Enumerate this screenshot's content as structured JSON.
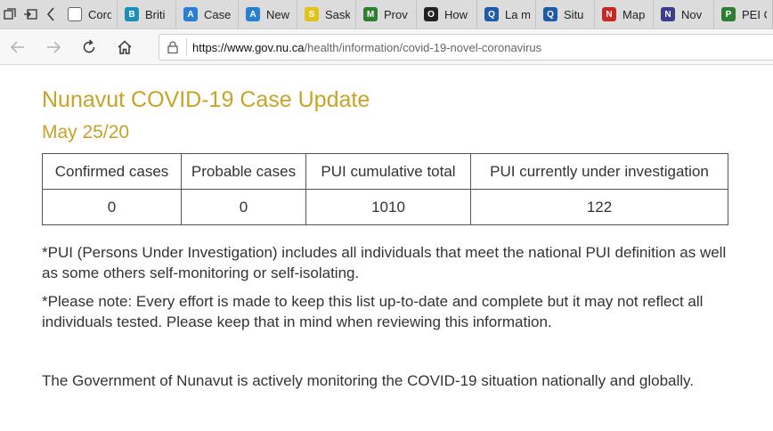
{
  "browser": {
    "tabs": [
      {
        "title": "Coro",
        "icon": "document-icon",
        "color": "#666666",
        "glyph": ""
      },
      {
        "title": "Briti",
        "icon": "bc-gov-icon",
        "color": "#1a8fb5",
        "glyph": "B"
      },
      {
        "title": "Case",
        "icon": "alberta-icon",
        "color": "#2a7fd0",
        "glyph": "A"
      },
      {
        "title": "New",
        "icon": "alberta-icon",
        "color": "#2a7fd0",
        "glyph": "A"
      },
      {
        "title": "Sask",
        "icon": "saskatchewan-icon",
        "color": "#e3c21a",
        "glyph": "S"
      },
      {
        "title": "Prov",
        "icon": "manitoba-icon",
        "color": "#2e7d32",
        "glyph": "M"
      },
      {
        "title": "How",
        "icon": "ontario-icon",
        "color": "#222222",
        "glyph": "O"
      },
      {
        "title": "La m",
        "icon": "quebec-fleur-icon",
        "color": "#1e5aa8",
        "glyph": "Q"
      },
      {
        "title": "Situ",
        "icon": "quebec-fleur-icon",
        "color": "#1e5aa8",
        "glyph": "Q"
      },
      {
        "title": "Map",
        "icon": "nova-scotia-icon",
        "color": "#c62828",
        "glyph": "N"
      },
      {
        "title": "Nov",
        "icon": "new-brunswick-icon",
        "color": "#3c3c8c",
        "glyph": "N"
      },
      {
        "title": "PEI C",
        "icon": "pei-icon",
        "color": "#2e7d32",
        "glyph": "P"
      }
    ],
    "url_host": "https://www.gov.nu.ca",
    "url_path": "/health/information/covid-19-novel-coronavirus"
  },
  "page": {
    "title": "Nunavut COVID-19 Case Update",
    "date": "May 25/20",
    "table": {
      "headers": [
        "Confirmed cases",
        "Probable cases",
        "PUI cumulative total",
        "PUI currently under investigation"
      ],
      "row": [
        "0",
        "0",
        "1010",
        "122"
      ]
    },
    "pui_note": "*PUI (Persons Under Investigation) includes all individuals that meet the national PUI definition as well as some others self-monitoring or self-isolating.",
    "please_note": "*Please note: Every effort is made to keep this list up-to-date and complete but it may not reflect all individuals tested. Please keep that in mind when reviewing this information.",
    "monitoring": "The Government of Nunavut is actively monitoring the COVID-19 situation nationally and globally."
  },
  "colors": {
    "heading": "#c9a227",
    "tab_strip": "#dcdcdc"
  }
}
